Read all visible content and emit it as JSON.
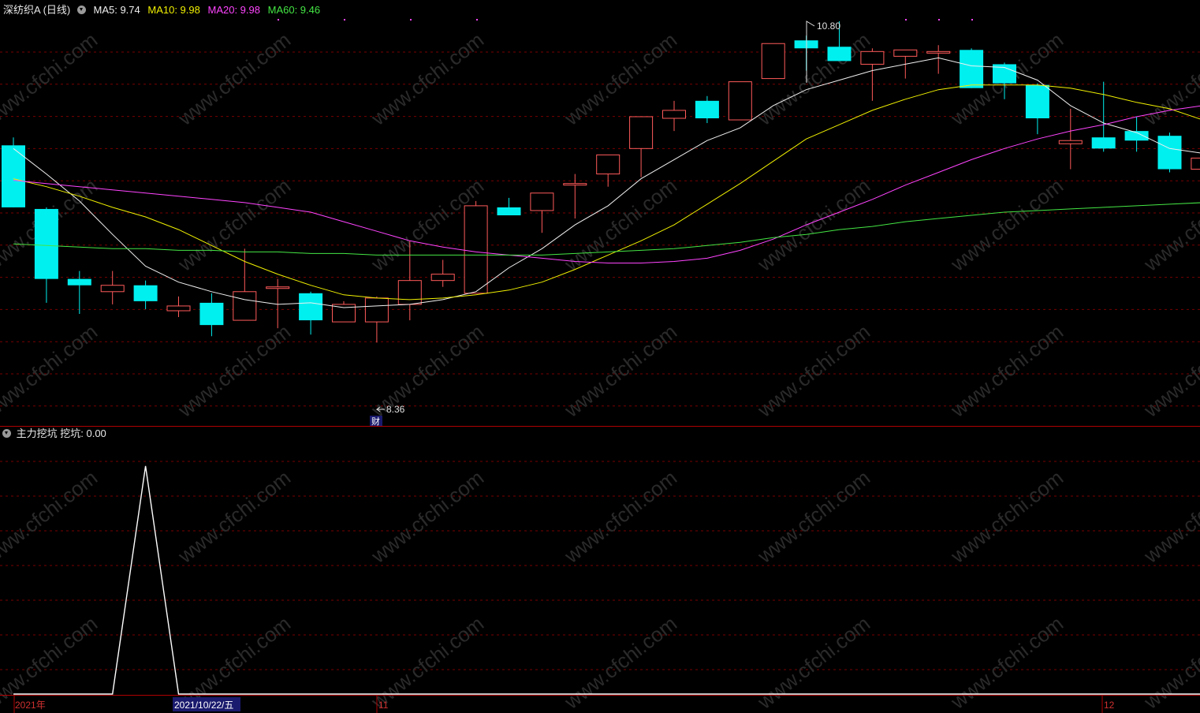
{
  "header": {
    "stock_name": "深纺织A (日线)",
    "ma": [
      {
        "label": "MA5: 9.74",
        "color": "#f0f0f0"
      },
      {
        "label": "MA10: 9.98",
        "color": "#f0f000"
      },
      {
        "label": "MA20: 9.98",
        "color": "#ff44ff"
      },
      {
        "label": "MA60: 9.46",
        "color": "#44e644"
      }
    ]
  },
  "indicator_panel": {
    "name": "主力挖坑",
    "value_label": "挖坑: 0.00"
  },
  "annotations": {
    "high_label": "10.80",
    "low_label": "8.36",
    "finance_mark": "财"
  },
  "date_axis": {
    "year_label": "2021年",
    "cursor_date": "2021/10/22/五",
    "month_11": "11",
    "month_12": "12"
  },
  "watermark": "www.cfchi.com",
  "colors": {
    "up": "#ff5a5a",
    "down": "#00f0f0",
    "ma5": "#f0f0f0",
    "ma10": "#f0f000",
    "ma20": "#ff44ff",
    "ma60": "#44e644",
    "grid": "#7a0000",
    "indicator": "#ffffff"
  },
  "chart_data": [
    {
      "type": "candlestick",
      "title": "深纺织A (日线)",
      "series_candles": {
        "name": "深纺织A (日线)",
        "ohlc": [
          [
            10.02,
            10.07,
            9.63,
            9.63
          ],
          [
            9.62,
            9.63,
            9.03,
            9.18
          ],
          [
            9.18,
            9.23,
            8.96,
            9.14
          ],
          [
            9.1,
            9.23,
            9.02,
            9.14
          ],
          [
            9.14,
            9.17,
            8.99,
            9.04
          ],
          [
            8.98,
            9.07,
            8.94,
            9.01
          ],
          [
            9.03,
            9.09,
            8.82,
            8.89
          ],
          [
            8.92,
            9.37,
            8.93,
            9.1
          ],
          [
            9.13,
            9.18,
            8.87,
            9.13
          ],
          [
            9.09,
            9.1,
            8.83,
            8.92
          ],
          [
            8.91,
            9.04,
            8.92,
            9.02
          ],
          [
            8.91,
            9.07,
            8.78,
            9.06
          ],
          [
            9.02,
            9.42,
            8.92,
            9.17
          ],
          [
            9.17,
            9.3,
            9.13,
            9.21
          ],
          [
            9.09,
            9.67,
            9.09,
            9.64
          ],
          [
            9.63,
            9.69,
            9.6,
            9.58
          ],
          [
            9.61,
            9.72,
            9.47,
            9.72
          ],
          [
            9.77,
            9.84,
            9.56,
            9.78
          ],
          [
            9.84,
            9.89,
            9.76,
            9.96
          ],
          [
            10.0,
            10.08,
            9.82,
            10.2
          ],
          [
            10.19,
            10.3,
            10.11,
            10.24
          ],
          [
            10.3,
            10.33,
            10.16,
            10.19
          ],
          [
            10.18,
            10.4,
            10.18,
            10.42
          ],
          [
            10.44,
            10.64,
            10.44,
            10.66
          ],
          [
            10.68,
            10.71,
            10.49,
            10.63
          ],
          [
            10.64,
            10.8,
            10.61,
            10.55
          ],
          [
            10.53,
            10.63,
            10.3,
            10.61
          ],
          [
            10.58,
            10.62,
            10.44,
            10.62
          ],
          [
            10.6,
            10.65,
            10.47,
            10.61
          ],
          [
            10.62,
            10.63,
            10.38,
            10.38
          ],
          [
            10.53,
            10.54,
            10.31,
            10.41
          ],
          [
            10.4,
            10.41,
            10.09,
            10.19
          ],
          [
            10.03,
            10.25,
            9.87,
            10.05
          ],
          [
            10.07,
            10.42,
            9.98,
            10.0
          ],
          [
            10.11,
            10.2,
            9.98,
            10.05
          ],
          [
            10.08,
            10.1,
            9.85,
            9.87
          ],
          [
            9.87,
            9.98,
            9.84,
            9.94
          ]
        ]
      },
      "series": [
        {
          "name": "MA5",
          "values": [
            10.0,
            9.84,
            9.67,
            9.46,
            9.26,
            9.16,
            9.1,
            9.05,
            9.02,
            9.03,
            9.0,
            9.01,
            9.02,
            9.05,
            9.1,
            9.25,
            9.37,
            9.52,
            9.64,
            9.81,
            9.93,
            10.05,
            10.13,
            10.27,
            10.37,
            10.43,
            10.49,
            10.53,
            10.57,
            10.52,
            10.51,
            10.43,
            10.27,
            10.16,
            10.1,
            10.0,
            9.97
          ]
        },
        {
          "name": "MA10",
          "values": [
            9.81,
            9.76,
            9.7,
            9.63,
            9.57,
            9.49,
            9.39,
            9.29,
            9.21,
            9.14,
            9.08,
            9.06,
            9.05,
            9.06,
            9.08,
            9.11,
            9.16,
            9.24,
            9.33,
            9.42,
            9.52,
            9.65,
            9.78,
            9.92,
            10.06,
            10.15,
            10.24,
            10.31,
            10.37,
            10.4,
            10.4,
            10.4,
            10.38,
            10.34,
            10.29,
            10.25,
            10.18
          ]
        },
        {
          "name": "MA20",
          "values": [
            9.8,
            9.78,
            9.76,
            9.74,
            9.72,
            9.7,
            9.68,
            9.66,
            9.63,
            9.6,
            9.54,
            9.48,
            9.42,
            9.38,
            9.35,
            9.33,
            9.31,
            9.29,
            9.28,
            9.28,
            9.29,
            9.31,
            9.36,
            9.43,
            9.52,
            9.6,
            9.68,
            9.77,
            9.85,
            9.93,
            10.0,
            10.06,
            10.11,
            10.15,
            10.2,
            10.24,
            10.27
          ]
        },
        {
          "name": "MA60",
          "values": [
            9.4,
            9.39,
            9.38,
            9.37,
            9.37,
            9.36,
            9.36,
            9.35,
            9.35,
            9.34,
            9.34,
            9.33,
            9.33,
            9.33,
            9.33,
            9.33,
            9.33,
            9.34,
            9.35,
            9.36,
            9.37,
            9.39,
            9.41,
            9.44,
            9.46,
            9.49,
            9.51,
            9.54,
            9.56,
            9.58,
            9.6,
            9.61,
            9.62,
            9.63,
            9.64,
            9.65,
            9.66
          ]
        }
      ]
    },
    {
      "type": "line",
      "title": "主力挖坑",
      "series": [
        {
          "name": "挖坑",
          "values": [
            0,
            0,
            0,
            0,
            2,
            0,
            0,
            0,
            0,
            0,
            0,
            0,
            0,
            0,
            0,
            0,
            0,
            0,
            0,
            0,
            0,
            0,
            0,
            0,
            0,
            0,
            0,
            0,
            0,
            0,
            0,
            0,
            0,
            0,
            0,
            0,
            0
          ]
        }
      ],
      "ylim": [
        0,
        2.2
      ]
    }
  ]
}
